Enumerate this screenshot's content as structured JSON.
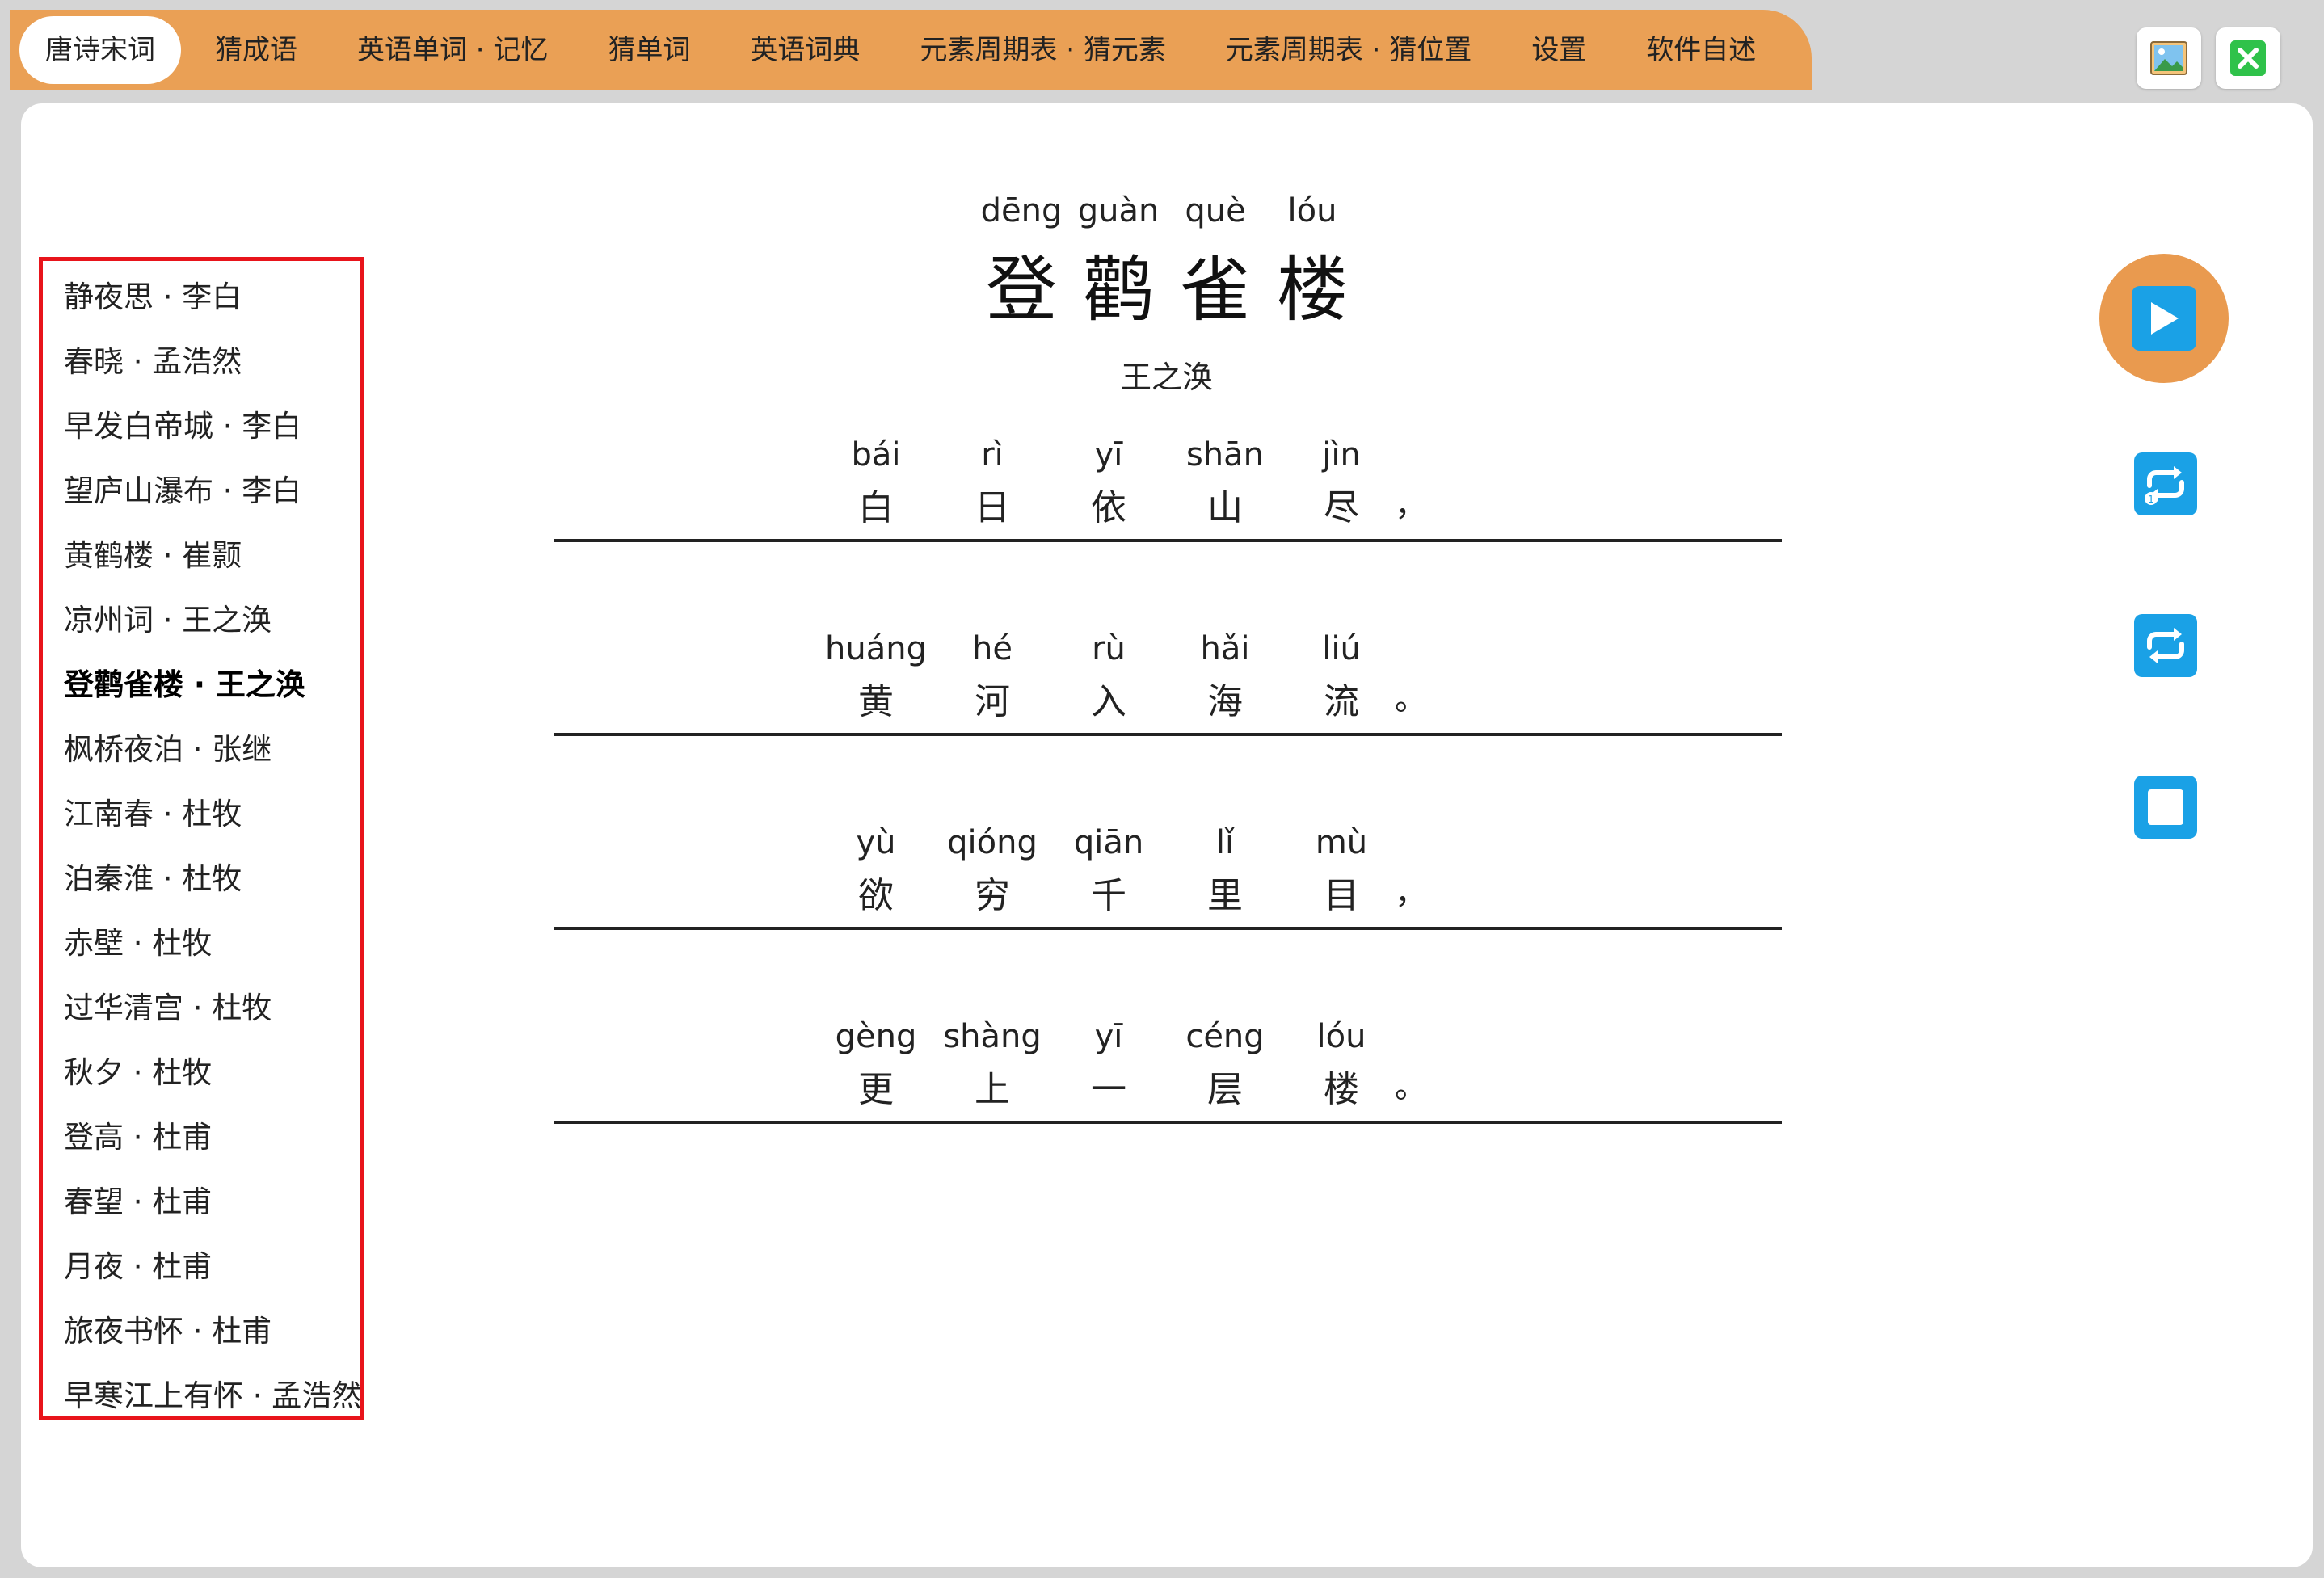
{
  "tabs": [
    {
      "label": "唐诗宋词",
      "active": true
    },
    {
      "label": "猜成语"
    },
    {
      "label": "英语单词 · 记忆"
    },
    {
      "label": "猜单词"
    },
    {
      "label": "英语词典"
    },
    {
      "label": "元素周期表 · 猜元素"
    },
    {
      "label": "元素周期表 · 猜位置"
    },
    {
      "label": "设置"
    },
    {
      "label": "软件自述"
    }
  ],
  "window_buttons": {
    "image_icon": "image-icon",
    "close_icon": "close-icon"
  },
  "poem_list": [
    "静夜思 · 李白",
    "春晓 · 孟浩然",
    "早发白帝城 · 李白",
    "望庐山瀑布 · 李白",
    "黄鹤楼 · 崔颢",
    "凉州词 · 王之涣",
    "登鹳雀楼 · 王之涣",
    "枫桥夜泊 · 张继",
    "江南春 · 杜牧",
    "泊秦淮 · 杜牧",
    "赤壁 · 杜牧",
    "过华清宫 · 杜牧",
    "秋夕 · 杜牧",
    "登高 · 杜甫",
    "春望 · 杜甫",
    "月夜 · 杜甫",
    "旅夜书怀 · 杜甫",
    "早寒江上有怀 · 孟浩然"
  ],
  "selected_poem": "登鹳雀楼 · 王之涣",
  "poem": {
    "title_pinyin": [
      "dēng",
      "guàn",
      "què",
      "lóu"
    ],
    "title_chars": [
      "登",
      "鹳",
      "雀",
      "楼"
    ],
    "author": "王之涣",
    "lines": [
      {
        "pinyin": [
          "bái",
          "rì",
          "yī",
          "shān",
          "jìn"
        ],
        "chars": [
          "白",
          "日",
          "依",
          "山",
          "尽"
        ],
        "punct": "，"
      },
      {
        "pinyin": [
          "huáng",
          "hé",
          "rù",
          "hǎi",
          "liú"
        ],
        "chars": [
          "黄",
          "河",
          "入",
          "海",
          "流"
        ],
        "punct": "。"
      },
      {
        "pinyin": [
          "yù",
          "qióng",
          "qiān",
          "lǐ",
          "mù"
        ],
        "chars": [
          "欲",
          "穷",
          "千",
          "里",
          "目"
        ],
        "punct": "，"
      },
      {
        "pinyin": [
          "gèng",
          "shàng",
          "yī",
          "céng",
          "lóu"
        ],
        "chars": [
          "更",
          "上",
          "一",
          "层",
          "楼"
        ],
        "punct": "。"
      }
    ]
  },
  "controls": [
    "play-icon",
    "repeat-once-icon",
    "repeat-icon",
    "stop-icon"
  ],
  "colors": {
    "tab_bar": "#eaa055",
    "play_button": "#e99a4f",
    "control_blue": "#1aa1e6",
    "list_border": "#e8141b"
  }
}
